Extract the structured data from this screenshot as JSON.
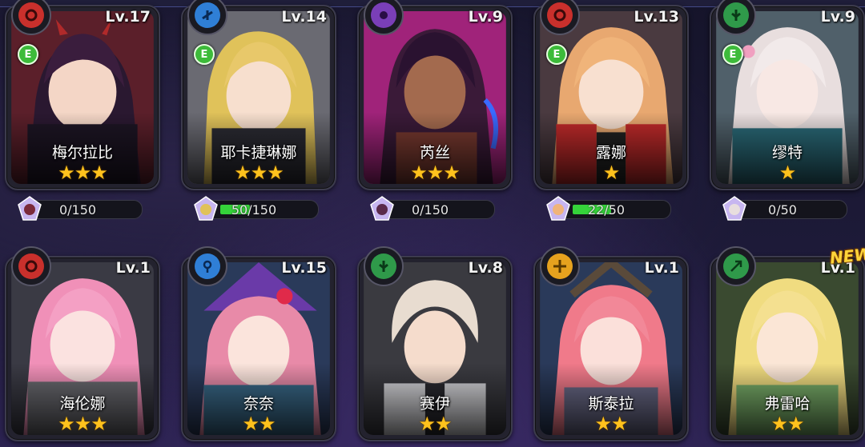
{
  "colors": {
    "star": "#ffc21d",
    "progress_fill": "#35d33a",
    "equip_badge": "#3dbb3a",
    "new_badge": "#ffd43a",
    "element_fire": "#c9302c",
    "element_water": "#2f7fd6",
    "element_dark": "#7a3fb8",
    "element_wood": "#2f9a4a",
    "element_light": "#e6a21e"
  },
  "characters": [
    {
      "name": "梅尔拉比",
      "level": "Lv.17",
      "stars": "★★★",
      "star_count": 3,
      "element": "fire",
      "equip": "E",
      "shard_progress": "0/150",
      "fill": 0
    },
    {
      "name": "耶卡捷琳娜",
      "level": "Lv.14",
      "stars": "★★★",
      "star_count": 3,
      "element": "water",
      "equip": "E",
      "shard_progress": "50/150",
      "fill": 0.333
    },
    {
      "name": "芮丝",
      "level": "Lv.9",
      "stars": "★★★",
      "star_count": 3,
      "element": "dark",
      "equip": "",
      "shard_progress": "0/150",
      "fill": 0
    },
    {
      "name": "露娜",
      "level": "Lv.13",
      "stars": "★",
      "star_count": 1,
      "element": "fire",
      "equip": "E",
      "shard_progress": "22/50",
      "fill": 0.44
    },
    {
      "name": "缪特",
      "level": "Lv.9",
      "stars": "★",
      "star_count": 1,
      "element": "wood",
      "equip": "E",
      "shard_progress": "0/50",
      "fill": 0
    },
    {
      "name": "海伦娜",
      "level": "Lv.1",
      "stars": "★★★",
      "star_count": 3,
      "element": "fire",
      "equip": ""
    },
    {
      "name": "奈奈",
      "level": "Lv.15",
      "stars": "★★",
      "star_count": 2,
      "element": "water",
      "equip": ""
    },
    {
      "name": "赛伊",
      "level": "Lv.8",
      "stars": "★★",
      "star_count": 2,
      "element": "wood",
      "equip": ""
    },
    {
      "name": "斯泰拉",
      "level": "Lv.1",
      "stars": "★★",
      "star_count": 2,
      "element": "light",
      "equip": ""
    },
    {
      "name": "弗雷哈",
      "level": "Lv.1",
      "stars": "★★",
      "star_count": 2,
      "element": "wood",
      "equip": "",
      "new_label": "NEW"
    }
  ]
}
